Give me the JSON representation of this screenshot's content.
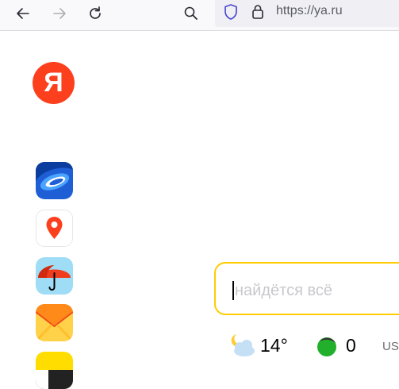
{
  "browser": {
    "back_icon": "arrow-left-icon",
    "forward_icon": "arrow-right-icon",
    "reload_icon": "reload-icon",
    "search_icon": "search-icon",
    "url": "https://ya.ru"
  },
  "logo": {
    "letter": "Я",
    "color": "#fc3f1d"
  },
  "apps": [
    {
      "name": "disk",
      "icon": "disk-app-icon"
    },
    {
      "name": "maps",
      "icon": "map-pin-app-icon"
    },
    {
      "name": "weather",
      "icon": "umbrella-app-icon"
    },
    {
      "name": "mail",
      "icon": "envelope-app-icon"
    },
    {
      "name": "taxi",
      "icon": "taxi-app-icon"
    }
  ],
  "search": {
    "placeholder": "найдётся всё",
    "value": "",
    "border_color": "#ffcc00"
  },
  "widgets": {
    "weather": {
      "icon": "moon-cloud-icon",
      "temperature": "14°"
    },
    "traffic": {
      "icon": "traffic-dot-icon",
      "value": "0"
    },
    "currency": {
      "label": "US"
    }
  }
}
